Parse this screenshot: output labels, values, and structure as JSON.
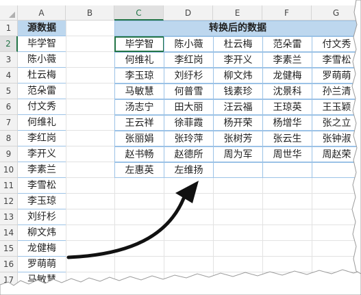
{
  "columns": [
    "A",
    "B",
    "C",
    "D",
    "E",
    "F",
    "G"
  ],
  "rows": [
    "1",
    "2",
    "3",
    "4",
    "5",
    "6",
    "7",
    "8",
    "9",
    "10",
    "11",
    "12",
    "13",
    "14",
    "15",
    "16",
    "17"
  ],
  "col_a": {
    "header": "源数据",
    "values": [
      "毕学智",
      "陈小薇",
      "杜云梅",
      "范朵雷",
      "付文秀",
      "何维礼",
      "李红岗",
      "李开义",
      "李素兰",
      "李雪松",
      "李玉琼",
      "刘纡杉",
      "柳文炜",
      "龙健梅",
      "罗萌萌",
      "马敏慧"
    ]
  },
  "table": {
    "title": "转换后的数据",
    "rows": [
      [
        "毕学智",
        "陈小薇",
        "杜云梅",
        "范朵雷",
        "付文秀"
      ],
      [
        "何维礼",
        "李红岗",
        "李开义",
        "李素兰",
        "李雪松"
      ],
      [
        "李玉琼",
        "刘纡杉",
        "柳文炜",
        "龙健梅",
        "罗萌萌"
      ],
      [
        "马敏慧",
        "何普雪",
        "钱素珍",
        "沈景科",
        "孙兰清"
      ],
      [
        "汤志宁",
        "田大丽",
        "汪云福",
        "王琼英",
        "王玉颖"
      ],
      [
        "王云祥",
        "徐菲霞",
        "杨开荣",
        "杨增华",
        "张之立"
      ],
      [
        "张丽娟",
        "张玲萍",
        "张树芳",
        "张云生",
        "张钟淑"
      ],
      [
        "赵书畅",
        "赵德所",
        "周为军",
        "周世华",
        "周赵荣"
      ],
      [
        "左惠英",
        "左维扬",
        "",
        "",
        ""
      ]
    ]
  },
  "colors": {
    "header_fill": "#bdd7ee",
    "border": "#9bc2e6",
    "select_green": "#217346"
  }
}
